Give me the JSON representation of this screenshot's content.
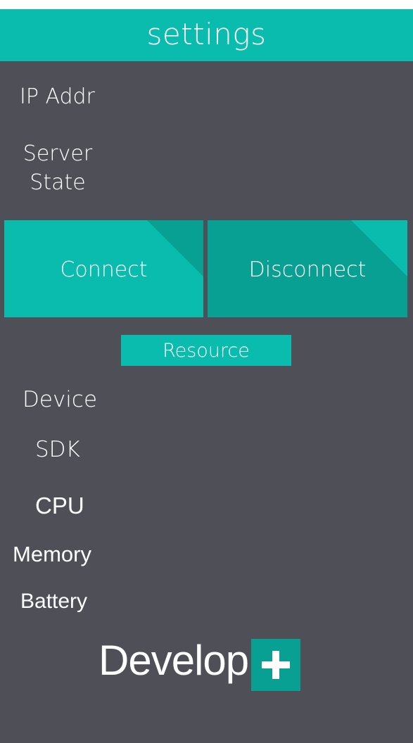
{
  "header": {
    "title": "settings"
  },
  "info": {
    "ip_label": "IP Addr",
    "server_state_line1": "Server",
    "server_state_line2": "State"
  },
  "actions": {
    "connect_label": "Connect",
    "disconnect_label": "Disconnect"
  },
  "resource": {
    "title": "Resource",
    "items": [
      "Device",
      "SDK",
      "CPU",
      "Memory",
      "Battery"
    ]
  },
  "logo": {
    "text": "Develop",
    "icon": "plus-icon"
  },
  "colors": {
    "accent": "#0abcad",
    "accent_dark": "#07a093",
    "background": "#4f4f58",
    "text": "#ffffff"
  }
}
